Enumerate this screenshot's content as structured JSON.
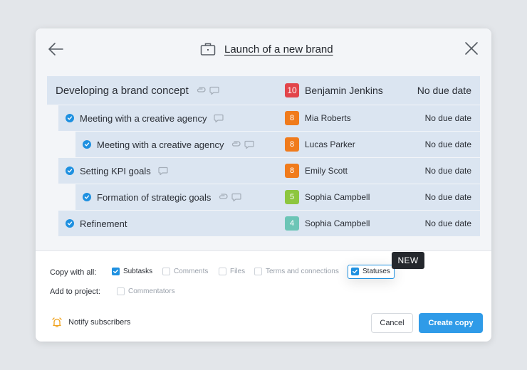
{
  "dialog": {
    "title": "Launch of a new brand"
  },
  "tasks": [
    {
      "name": "Developing a brand concept",
      "priority": "10",
      "priority_color": "#e2454b",
      "assignee": "Benjamin Jenkins",
      "due": "No due date",
      "checked": false
    },
    {
      "name": "Meeting with a creative agency",
      "priority": "8",
      "priority_color": "#f07b1c",
      "assignee": "Mia Roberts",
      "due": "No due date",
      "checked": true
    },
    {
      "name": "Meeting with a creative agency",
      "priority": "8",
      "priority_color": "#f07b1c",
      "assignee": "Lucas Parker",
      "due": "No due date",
      "checked": true
    },
    {
      "name": "Setting KPI goals",
      "priority": "8",
      "priority_color": "#f07b1c",
      "assignee": "Emily Scott",
      "due": "No due date",
      "checked": true
    },
    {
      "name": "Formation of strategic goals",
      "priority": "5",
      "priority_color": "#8dc63f",
      "assignee": "Sophia Campbell",
      "due": "No due date",
      "checked": true
    },
    {
      "name": "Refinement",
      "priority": "4",
      "priority_color": "#6cc5b6",
      "assignee": "Sophia Campbell",
      "due": "No due date",
      "checked": true
    }
  ],
  "options": {
    "copy_with_all_label": "Copy with all:",
    "subtasks": "Subtasks",
    "comments": "Comments",
    "files": "Files",
    "terms": "Terms and connections",
    "statuses": "Statuses",
    "new_badge": "NEW",
    "add_to_project_label": "Add to project:",
    "commentators": "Commentators"
  },
  "footer": {
    "notify": "Notify subscribers",
    "cancel": "Cancel",
    "create": "Create copy"
  },
  "colors": {
    "accent": "#2f9be8",
    "row_bg": "#dbe5f1"
  }
}
